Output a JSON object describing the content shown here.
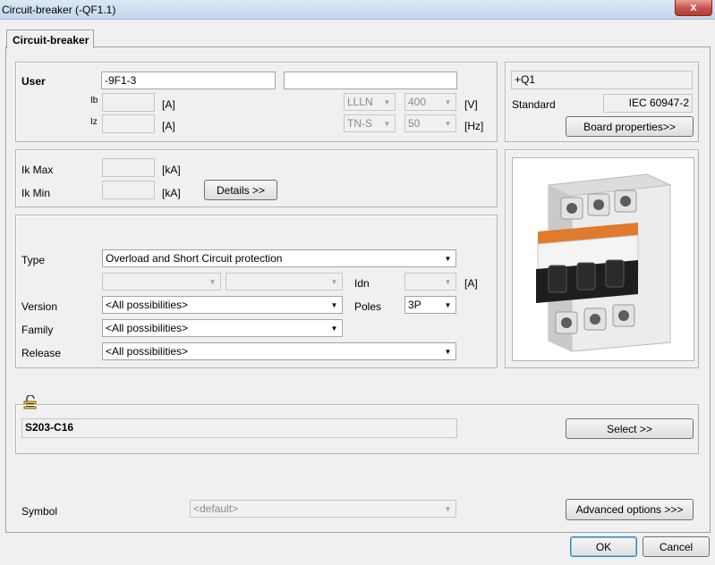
{
  "window": {
    "title": "Circuit-breaker (-QF1.1)",
    "close_label": "x"
  },
  "tab": {
    "label": "Circuit-breaker"
  },
  "user_group": {
    "user_label": "User",
    "user_value": "-9F1-3",
    "user_extra_value": "",
    "ib_label": "Ib",
    "ib_unit": "[A]",
    "iz_label": "Iz",
    "iz_unit": "[A]",
    "distribution_value": "LLLN",
    "voltage_value": "400",
    "voltage_unit": "[V]",
    "earthing_value": "TN-S",
    "frequency_value": "50",
    "frequency_unit": "[Hz]"
  },
  "board_group": {
    "board_value": "+Q1",
    "standard_label": "Standard",
    "standard_value": "IEC 60947-2",
    "board_properties_button": "Board properties>>"
  },
  "ik_group": {
    "ik_max_label": "Ik Max",
    "ik_max_unit": "[kA]",
    "ik_min_label": "Ik Min",
    "ik_min_unit": "[kA]",
    "details_button": "Details >>"
  },
  "selection_group": {
    "type_label": "Type",
    "type_value": "Overload and Short Circuit protection",
    "idn_label": "Idn",
    "idn_unit": "[A]",
    "version_label": "Version",
    "version_value": "<All possibilities>",
    "poles_label": "Poles",
    "poles_value": "3P",
    "family_label": "Family",
    "family_value": "<All possibilities>",
    "release_label": "Release",
    "release_value": "<All possibilities>"
  },
  "product_group": {
    "product_value": "S203-C16",
    "select_button": "Select >>"
  },
  "footer": {
    "symbol_label": "Symbol",
    "symbol_value": "<default>",
    "advanced_button": "Advanced options >>>",
    "ok_button": "OK",
    "cancel_button": "Cancel"
  }
}
